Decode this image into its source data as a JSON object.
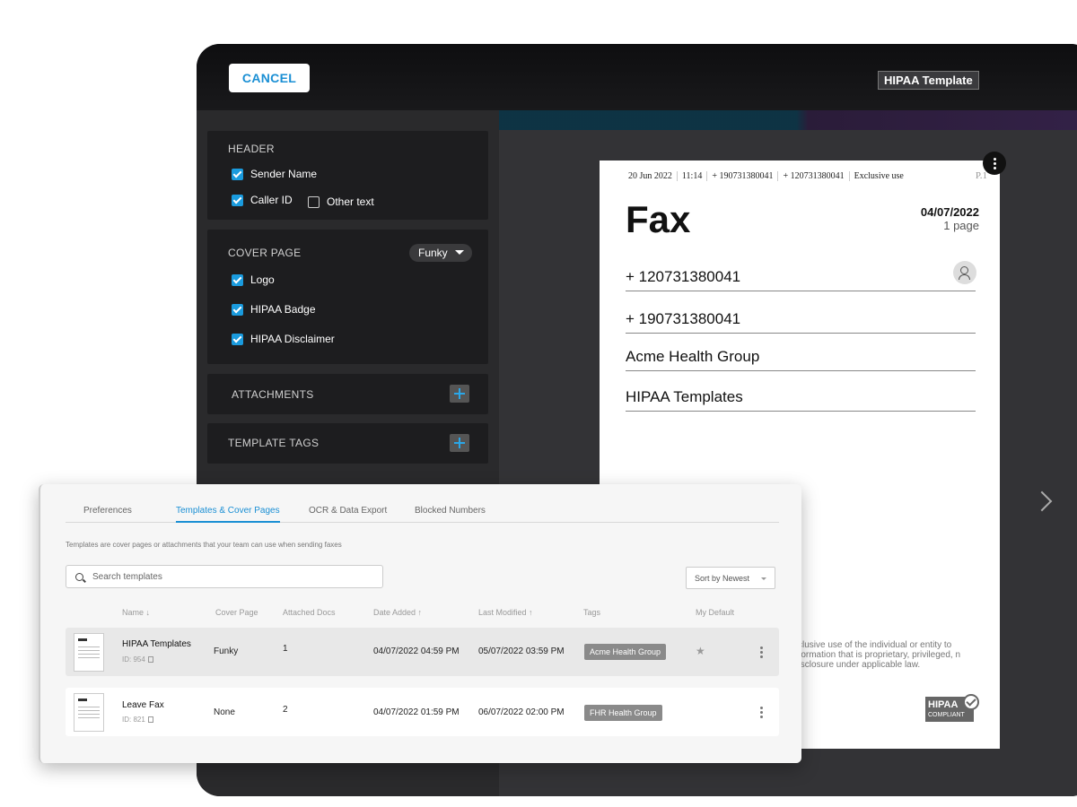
{
  "editor": {
    "cancel_label": "CANCEL",
    "template_title": "HIPAA Template",
    "header_section": {
      "title": "HEADER",
      "sender_name": "Sender Name",
      "caller_id": "Caller ID",
      "other_text": "Other text"
    },
    "cover_section": {
      "title": "COVER PAGE",
      "style_value": "Funky",
      "logo": "Logo",
      "hipaa_badge": "HIPAA Badge",
      "hipaa_disclaimer": "HIPAA Disclaimer"
    },
    "attachments_label": "ATTACHMENTS",
    "template_tags_label": "TEMPLATE TAGS"
  },
  "fax": {
    "meta": [
      "20 Jun 2022",
      "11:14",
      "+ 190731380041",
      "+ 120731380041",
      "Exclusive use"
    ],
    "page_indicator": "P.1",
    "title": "Fax",
    "date": "04/07/2022",
    "page_count": "1 page",
    "to_number": "+ 120731380041",
    "from_number": "+ 190731380041",
    "company": "Acme Health Group",
    "subject": "HIPAA Templates",
    "disclaimer": "xclusive use of the individual or entity to nformation that is proprietary, privileged, n disclosure under applicable law.",
    "badge_text": "HIPAA",
    "badge_sub": "COMPLIANT"
  },
  "settings": {
    "tabs": [
      {
        "label": "Preferences"
      },
      {
        "label": "Templates & Cover Pages"
      },
      {
        "label": "OCR & Data Export"
      },
      {
        "label": "Blocked Numbers"
      }
    ],
    "hint": "Templates are cover pages or attachments that your team can use when sending faxes",
    "search_placeholder": "Search templates",
    "sort_label": "Sort by Newest",
    "columns": {
      "name": "Name ↓",
      "cover_page": "Cover Page",
      "attached_docs": "Attached Docs",
      "date_added": "Date Added ↑",
      "last_modified": "Last Modified ↑",
      "tags": "Tags",
      "my_default": "My Default"
    },
    "rows": [
      {
        "name": "HIPAA Templates",
        "id": "ID: 954",
        "cover": "Funky",
        "docs": "1",
        "added": "04/07/2022 04:59 PM",
        "modified": "05/07/2022 03:59 PM",
        "tag": "Acme Health Group",
        "default_icon": "★"
      },
      {
        "name": "Leave Fax",
        "id": "ID: 821",
        "cover": "None",
        "docs": "2",
        "added": "04/07/2022 01:59 PM",
        "modified": "06/07/2022 02:00 PM",
        "tag": "FHR Health Group"
      }
    ]
  }
}
